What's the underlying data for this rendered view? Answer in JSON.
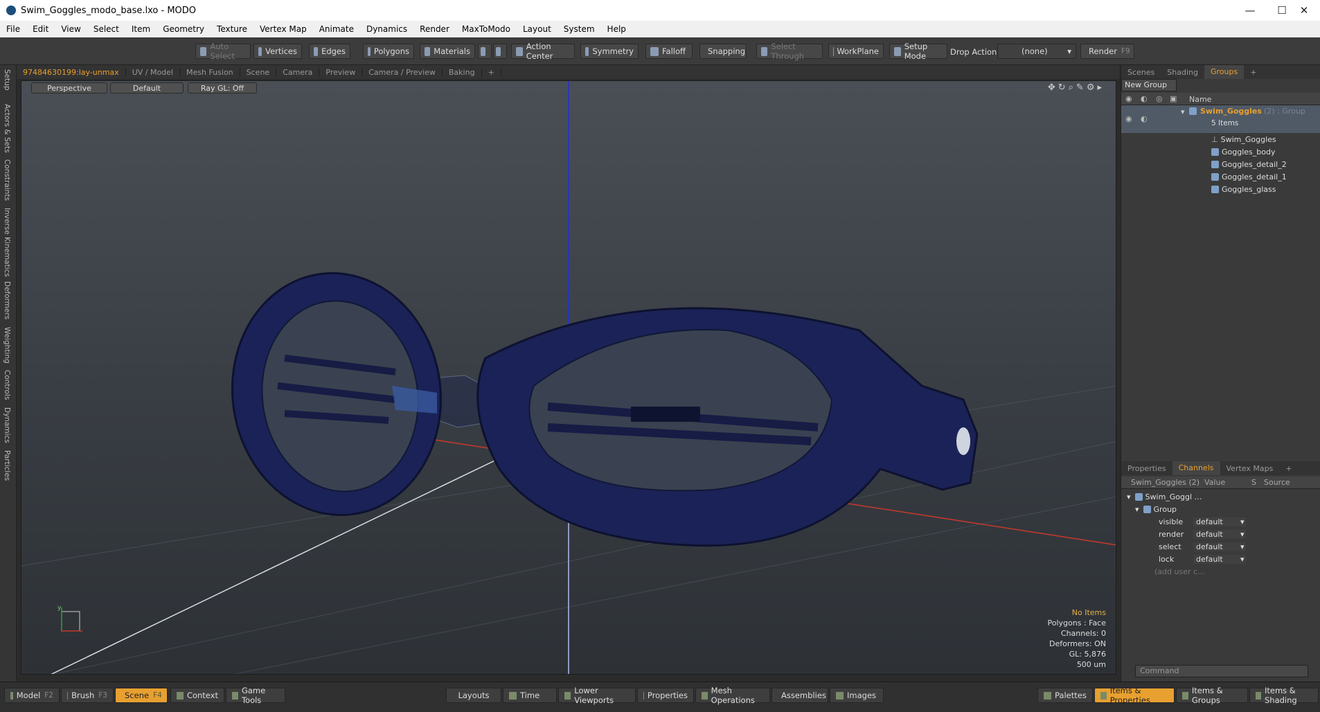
{
  "window": {
    "title": "Swim_Goggles_modo_base.lxo - MODO",
    "min_glyph": "—",
    "max_glyph": "☐",
    "close_glyph": "✕"
  },
  "menu": [
    "File",
    "Edit",
    "View",
    "Select",
    "Item",
    "Geometry",
    "Texture",
    "Vertex Map",
    "Animate",
    "Dynamics",
    "Render",
    "MaxToModo",
    "Layout",
    "System",
    "Help"
  ],
  "toolbar": {
    "auto_select": "Auto Select",
    "vertices": "Vertices",
    "edges": "Edges",
    "polygons": "Polygons",
    "materials": "Materials",
    "action_center": "Action Center",
    "symmetry": "Symmetry",
    "falloff": "Falloff",
    "snapping": "Snapping",
    "select_through": "Select Through",
    "workplane": "WorkPlane",
    "setup_mode": "Setup Mode",
    "drop_action": "Drop Action",
    "drop_value": "(none)",
    "render": "Render",
    "render_key": "F9"
  },
  "left_tabs": [
    "Setup",
    "Actors & Sets",
    "Constraints",
    "Inverse Kinematics",
    "Deformers",
    "Weighting",
    "Controls",
    "Dynamics",
    "Particles"
  ],
  "viewport_tabs": [
    "97484630199:lay-unmax",
    "UV / Model",
    "Mesh Fusion",
    "Scene",
    "Camera",
    "Preview",
    "Camera / Preview",
    "Baking",
    "+"
  ],
  "viewport": {
    "perspective": "Perspective",
    "default": "Default",
    "raygl": "Ray GL: Off",
    "info_no_items": "No Items",
    "info_polygons": "Polygons : Face",
    "info_channels": "Channels: 0",
    "info_deformers": "Deformers: ON",
    "info_gl": "GL: 5,876",
    "info_scale": "500 um",
    "axis_y": "y"
  },
  "scene_panel": {
    "tabs": [
      "Scenes",
      "Shading",
      "Groups",
      "+"
    ],
    "new_group": "New Group",
    "col_name": "Name",
    "group_name": "Swim_Goggles",
    "group_suffix": "(2) : Group",
    "item_count": "5 Items",
    "items": [
      "Swim_Goggles",
      "Goggles_body",
      "Goggles_detail_2",
      "Goggles_detail_1",
      "Goggles_glass"
    ]
  },
  "channels_panel": {
    "tabs": [
      "Properties",
      "Channels",
      "Vertex Maps",
      "+"
    ],
    "header_name": "Swim_Goggles (2)",
    "header_value": "Value",
    "header_s": "S",
    "header_source": "Source",
    "root": "Swim_Goggl …",
    "group": "Group",
    "rows": [
      {
        "name": "visible",
        "value": "default"
      },
      {
        "name": "render",
        "value": "default"
      },
      {
        "name": "select",
        "value": "default"
      },
      {
        "name": "lock",
        "value": "default"
      }
    ],
    "add_user": "(add user c…",
    "command_placeholder": "Command"
  },
  "bottombar": {
    "model": "Model",
    "model_key": "F2",
    "brush": "Brush",
    "brush_key": "F3",
    "scene": "Scene",
    "scene_key": "F4",
    "context": "Context",
    "game_tools": "Game Tools",
    "layouts": "Layouts",
    "time": "Time",
    "lower_viewports": "Lower Viewports",
    "properties": "Properties",
    "mesh_operations": "Mesh Operations",
    "assemblies": "Assemblies",
    "images": "Images",
    "palettes": "Palettes",
    "items_properties": "Items & Properties",
    "items_groups": "Items & Groups",
    "items_shading": "Items & Shading"
  },
  "colors": {
    "accent": "#e8a030",
    "goggle_blue": "#1b2257",
    "axis_red": "#c0392b",
    "axis_green": "#2ea043",
    "axis_blue": "#2233cc"
  }
}
